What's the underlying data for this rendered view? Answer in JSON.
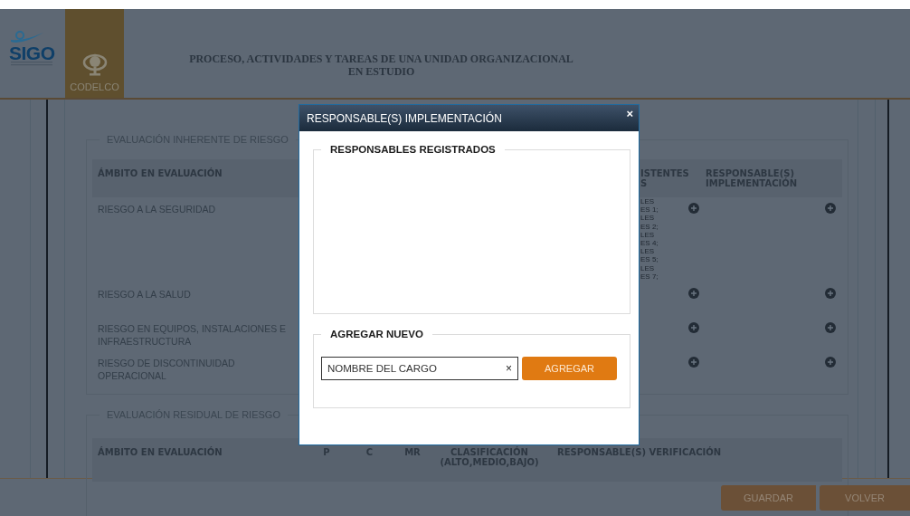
{
  "header": {
    "logo_text": "SIGO",
    "brand": "CODELCO",
    "title_lines": [
      "PROCESO, ACTIVIDADES Y TAREAS DE UNA UNIDAD ORGANIZACIONAL",
      "EN ESTUDIO"
    ]
  },
  "inherent": {
    "legend": "EVALUACIÓN INHERENTE DE RIESGO",
    "columns": [
      {
        "lines": [
          "ÁMBITO EN EVALUACIÓN"
        ]
      },
      {
        "lines": [
          "ISTENTES",
          "S"
        ]
      },
      {
        "lines": [
          "RESPONSABLE(S)",
          "IMPLEMENTACIÓN"
        ]
      }
    ],
    "rows": [
      {
        "ambito": "RIESGO A LA SEGURIDAD",
        "controls": [
          "LES",
          "ES 1;",
          "LES",
          "ES 2;",
          "LES",
          "ES 4;",
          "LES",
          "ES 5;",
          "LES",
          "ES 7;"
        ]
      },
      {
        "ambito": "RIESGO A LA SALUD",
        "controls": []
      },
      {
        "ambito": "RIESGO EN EQUIPOS, INSTALACIONES E INFRAESTRUCTURA",
        "controls": []
      },
      {
        "ambito": "RIESGO DE DISCONTINUIDAD OPERACIONAL",
        "controls": []
      }
    ]
  },
  "residual": {
    "legend": "EVALUACIÓN RESIDUAL DE RIESGO",
    "columns": [
      {
        "lines": [
          "ÁMBITO EN EVALUACIÓN"
        ]
      },
      {
        "lines": [
          "P"
        ]
      },
      {
        "lines": [
          "C"
        ]
      },
      {
        "lines": [
          "MR"
        ]
      },
      {
        "lines": [
          "CLASIFICACIÓN",
          "(ALTO,MEDIO,BAJO)"
        ]
      },
      {
        "lines": [
          "RESPONSABLE(S) VERIFICACIÓN"
        ]
      }
    ]
  },
  "modal": {
    "title": "RESPONSABLE(S) IMPLEMENTACIÓN",
    "close": "×",
    "registered_legend": "RESPONSABLES REGISTRADOS",
    "add_legend": "AGREGAR NUEVO",
    "field_value": "NOMBRE DEL CARGO",
    "clear": "×",
    "add_button": "AGREGAR"
  },
  "footer": {
    "buttons": [
      "GUARDAR",
      "VOLVER"
    ]
  }
}
